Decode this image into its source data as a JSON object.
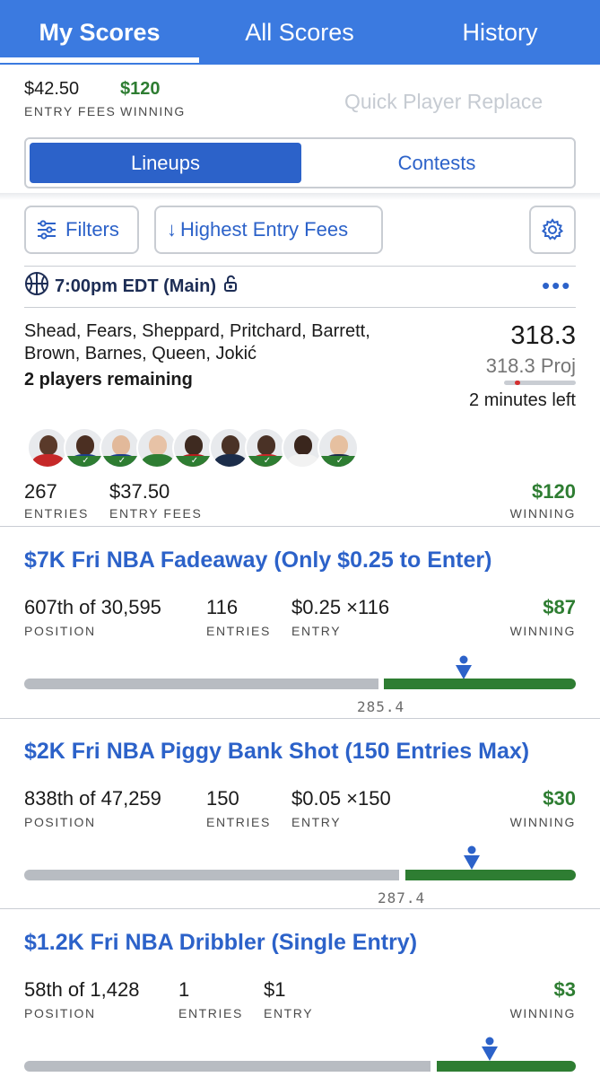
{
  "tabs": [
    {
      "label": "My Scores",
      "active": true
    },
    {
      "label": "All Scores",
      "active": false
    },
    {
      "label": "History",
      "active": false
    }
  ],
  "summary": {
    "entry_fees_value": "$42.50",
    "entry_fees_label": "ENTRY FEES",
    "winning_value": "$120",
    "winning_label": "WINNING",
    "quick_replace": "Quick Player Replace"
  },
  "segments": {
    "lineups": "Lineups",
    "contests": "Contests",
    "selected": "Lineups"
  },
  "filters": {
    "filters_label": "Filters",
    "sort_label": "Highest Entry Fees",
    "icons": {
      "filters": "sliders-icon",
      "sort": "arrow-down-icon",
      "settings": "gear-icon"
    }
  },
  "lineup": {
    "slate": "7:00pm EDT (Main)",
    "sport_icon": "basketball-icon",
    "lock_icon": "unlock-icon",
    "players_text": "Shead, Fears, Sheppard, Pritchard, Barrett, Brown, Barnes, Queen, Jokić",
    "remaining": "2 players remaining",
    "score": "318.3",
    "projection": "318.3 Proj",
    "time_left": "2 minutes left",
    "avatars": [
      {
        "skin": "#5a3a2a",
        "shirt": "#c62828",
        "done": false
      },
      {
        "skin": "#4b2f22",
        "shirt": "#1e3f8a",
        "done": true
      },
      {
        "skin": "#e2b99a",
        "shirt": "#1e3f8a",
        "done": true
      },
      {
        "skin": "#e7c2a6",
        "shirt": "#2e7d32",
        "done": false
      },
      {
        "skin": "#3e2a20",
        "shirt": "#b71c1c",
        "done": true
      },
      {
        "skin": "#4a3226",
        "shirt": "#1c2d4a",
        "done": false
      },
      {
        "skin": "#4a3226",
        "shirt": "#c62828",
        "done": true
      },
      {
        "skin": "#3a261d",
        "shirt": "#f2f2f2",
        "done": false
      },
      {
        "skin": "#e6c0a0",
        "shirt": "#1c2d4a",
        "done": true
      }
    ],
    "entries_value": "267",
    "entries_label": "ENTRIES",
    "fees_value": "$37.50",
    "fees_label": "ENTRY FEES",
    "winning_value": "$120",
    "winning_label": "WINNING"
  },
  "contests": [
    {
      "title": "$7K Fri NBA Fadeaway (Only $0.25 to Enter)",
      "position": "607th of 30,595",
      "position_label": "POSITION",
      "entries": "116",
      "entries_label": "ENTRIES",
      "entry": "$0.25 ×116",
      "entry_label": "ENTRY",
      "winning": "$87",
      "winning_label": "WINNING",
      "cutline": "285.4"
    },
    {
      "title": "$2K Fri NBA Piggy Bank Shot (150 Entries Max)",
      "position": "838th of 47,259",
      "position_label": "POSITION",
      "entries": "150",
      "entries_label": "ENTRIES",
      "entry": "$0.05 ×150",
      "entry_label": "ENTRY",
      "winning": "$30",
      "winning_label": "WINNING",
      "cutline": "287.4"
    },
    {
      "title": "$1.2K Fri NBA Dribbler (Single Entry)",
      "position": "58th of 1,428",
      "position_label": "POSITION",
      "entries": "1",
      "entries_label": "ENTRIES",
      "entry": "$1",
      "entry_label": "ENTRY",
      "winning": "$3",
      "winning_label": "WINNING",
      "cutline": ""
    }
  ]
}
